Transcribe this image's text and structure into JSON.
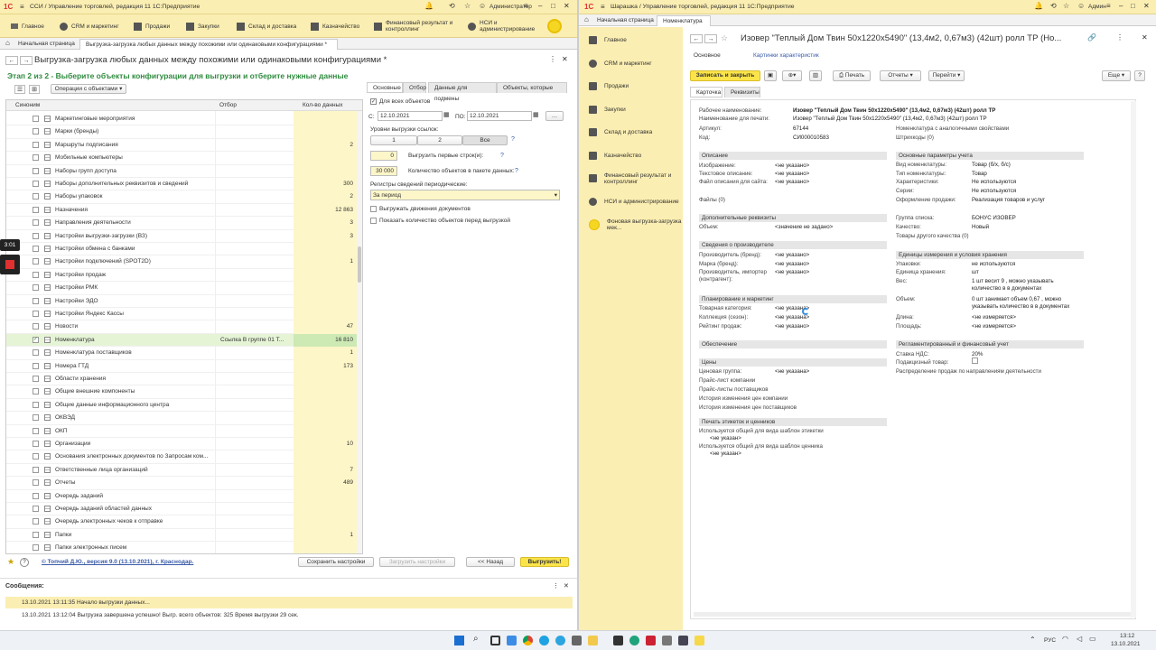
{
  "left": {
    "title": "ССИ / Управление торговлей, редакция 11 1С:Предприятие",
    "user": "Администратор",
    "menu": [
      "Главное",
      "CRM и маркетинг",
      "Продажи",
      "Закупки",
      "Склад и доставка",
      "Казначейство",
      "Финансовый результат и контроллинг",
      "НСИ и администрирование"
    ],
    "tabs": [
      "Начальная страница",
      "Выгрузка-загрузка любых данных между похожими или одинаковыми конфигурациями * ×"
    ],
    "form_title": "Выгрузка-загрузка любых данных между похожими или одинаковыми конфигурациями *",
    "step": "Этап 2 из 2 - Выберите объекты конфигурации для выгрузки и отберите нужные данные",
    "ops_label": "Операции с объектами",
    "col_synonym": "Синоним",
    "col_filter": "Отбор",
    "col_count": "Кол-во данных",
    "rows": [
      {
        "name": "Маркетинговые мероприятия",
        "filter": "",
        "count": ""
      },
      {
        "name": "Марки (бренды)",
        "filter": "",
        "count": ""
      },
      {
        "name": "Маршруты подписания",
        "filter": "",
        "count": "2"
      },
      {
        "name": "Мобильные компьютеры",
        "filter": "",
        "count": ""
      },
      {
        "name": "Наборы групп доступа",
        "filter": "",
        "count": ""
      },
      {
        "name": "Наборы дополнительных реквизитов и сведений",
        "filter": "",
        "count": "300"
      },
      {
        "name": "Наборы упаковок",
        "filter": "",
        "count": "2"
      },
      {
        "name": "Назначения",
        "filter": "",
        "count": "12 863"
      },
      {
        "name": "Направления деятельности",
        "filter": "",
        "count": "3"
      },
      {
        "name": "Настройки выгрузки-загрузки (ВЗ)",
        "filter": "",
        "count": "3"
      },
      {
        "name": "Настройки обмена с банками",
        "filter": "",
        "count": ""
      },
      {
        "name": "Настройки подключений (SPOT2D)",
        "filter": "",
        "count": "1"
      },
      {
        "name": "Настройки продаж",
        "filter": "",
        "count": ""
      },
      {
        "name": "Настройки РМК",
        "filter": "",
        "count": ""
      },
      {
        "name": "Настройки ЭДО",
        "filter": "",
        "count": ""
      },
      {
        "name": "Настройки Яндекс Кассы",
        "filter": "",
        "count": ""
      },
      {
        "name": "Новости",
        "filter": "",
        "count": "47"
      },
      {
        "name": "Номенклатура",
        "filter": "Ссылка В группе 01 Т...",
        "count": "16 810"
      },
      {
        "name": "Номенклатура поставщиков",
        "filter": "",
        "count": "1"
      },
      {
        "name": "Номера ГТД",
        "filter": "",
        "count": "173"
      },
      {
        "name": "Области хранения",
        "filter": "",
        "count": ""
      },
      {
        "name": "Общие внешние компоненты",
        "filter": "",
        "count": ""
      },
      {
        "name": "Общие данные информационного центра",
        "filter": "",
        "count": ""
      },
      {
        "name": "ОКВЭД",
        "filter": "",
        "count": ""
      },
      {
        "name": "ОКП",
        "filter": "",
        "count": ""
      },
      {
        "name": "Организации",
        "filter": "",
        "count": "10"
      },
      {
        "name": "Основания электронных документов по Запросам ком...",
        "filter": "",
        "count": ""
      },
      {
        "name": "Ответственные лица организаций",
        "filter": "",
        "count": "7"
      },
      {
        "name": "Отчеты",
        "filter": "",
        "count": "489"
      },
      {
        "name": "Очередь заданий",
        "filter": "",
        "count": ""
      },
      {
        "name": "Очередь заданий областей данных",
        "filter": "",
        "count": ""
      },
      {
        "name": "Очередь электронных чеков к отправке",
        "filter": "",
        "count": ""
      },
      {
        "name": "Папки",
        "filter": "",
        "count": "1"
      },
      {
        "name": "Папки электронных писем",
        "filter": "",
        "count": ""
      }
    ],
    "right_tabs": [
      "Основные",
      "Отбор",
      "Данные для подмены",
      "Объекты, которые бу..."
    ],
    "for_all": "Для всех объектов",
    "date_from_label": "С:",
    "date_from": "12.10.2021",
    "date_to_label": "ПО:",
    "date_to": "12.10.2021",
    "levels_label": "Уровни выгрузки ссылок:",
    "levels": [
      "1",
      "2",
      "Все"
    ],
    "first_rows_val": "0",
    "first_rows_label": "Выгрузить первые строк(и):",
    "packet_val": "30 000",
    "packet_label": "Количество объектов в пакете данных:",
    "registers_label": "Регистры сведений периодические:",
    "registers_val": "За период",
    "chk_movements": "Выгружать движения документов",
    "chk_show_count": "Показать количество объектов перед выгрузкой",
    "author": "© Топчий Д.Ю., версия 9.0 (13.10.2021), г. Краснодар.",
    "save_settings": "Сохранить настройки",
    "load_settings": "Загрузить настройки",
    "back": "<< Назад",
    "export": "Выгрузить!",
    "messages_title": "Сообщения:",
    "messages": [
      "13.10.2021 13:11:35 Начало выгрузки данных...",
      "13.10.2021 13:12:04 Выгрузка завершена успешно! Выгр. всего объектов: 325 Время выгрузки 29 сек."
    ],
    "timer": "3:01"
  },
  "right": {
    "title": "Шарашка / Управление торговлей, редакция 11 1С:Предприятие",
    "user": "Админ",
    "tabs": [
      "Начальная страница",
      "Номенклатура ×"
    ],
    "sidebar": [
      "Главное",
      "CRM и маркетинг",
      "Продажи",
      "Закупки",
      "Склад и доставка",
      "Казначейство",
      "Финансовый результат и контроллинг",
      "НСИ и администрирование",
      "Фоновая выгрузка-загрузка мек..."
    ],
    "card_title": "Изовер \"Теплый Дом Твин 50х1220х5490\" (13,4м2, 0,67м3) (42шт) ролл ТР (Но...",
    "nav_main": "Основное",
    "nav_chars": "Картинки характеристик",
    "write_close": "Записать и закрыть",
    "print": "Печать",
    "reports": "Отчеты",
    "goto": "Перейти",
    "more": "Еще",
    "help": "?",
    "subtabs": [
      "Карточка",
      "Реквизиты"
    ],
    "work_name_label": "Рабочее наименование:",
    "work_name": "Изовер \"Теплый Дом Твин 50х1220х5490\" (13,4м2, 0,67м3) (42шт) ролл ТР",
    "print_name_label": "Наименование для печати:",
    "print_name": "Изовер \"Теплый Дом Твин 50х1220х5490\" (13,4м2, 0,67м3) (42шт) ролл ТР",
    "article_label": "Артикул:",
    "article": "67144",
    "code_label": "Код:",
    "code": "СИ000010583",
    "analog_link": "Номенклатура с аналогичными свойствами",
    "barcodes_link": "Штрихкоды (0)",
    "s_description": "Описание",
    "image_label": "Изображение:",
    "not_set": "<не указано>",
    "text_desc_label": "Текстовое описание:",
    "site_file_label": "Файл описания для сайта:",
    "files_link": "Файлы (0)",
    "s_additional": "Дополнительные реквизиты",
    "volume_label": "Объем:",
    "value_not_set": "<значение не задано>",
    "s_manufacturer": "Сведения о производителе",
    "producer_label": "Производитель (бренд):",
    "brand_label": "Марка (бренд):",
    "importer_label": "Производитель, импортер (контрагент):",
    "s_planning": "Планирование и маркетинг",
    "category_label": "Товарная категория:",
    "not_set_f": "<не указана>",
    "collection_label": "Коллекция (сезон):",
    "rating_label": "Рейтинг продаж:",
    "s_supply": "Обеспечение",
    "s_prices": "Цены",
    "price_group_label": "Ценовая группа:",
    "price_links": [
      "Прайс-лист компании",
      "Прайс-листы поставщиков",
      "История изменения цен компании",
      "История изменения цен поставщиков"
    ],
    "s_labels": "Печать этикеток и ценников",
    "label_tmpl": "Используется общий для вида шаблон этикетки",
    "label_tmpl_val": "<не указан>",
    "price_tmpl": "Используется общий для вида шаблон ценника",
    "price_tmpl_val": "<не указан>",
    "s_accounting": "Основные параметры учета",
    "kind_label": "Вид номенклатуры:",
    "kind": "Товар (б/х, б/с)",
    "type_label": "Тип номенклатуры:",
    "type": "Товар",
    "chars_label": "Характеристики:",
    "not_used": "Не используются",
    "series_label": "Серии:",
    "sale_label": "Оформление продажи:",
    "sale": "Реализация товаров и услуг",
    "group_label": "Группа списка:",
    "group": "БОНУС ИЗОВЕР",
    "quality_label": "Качество:",
    "quality": "Новый",
    "other_quality": "Товары другого качества (0)",
    "s_units": "Единицы измерения и условия хранения",
    "packs_label": "Упаковки:",
    "packs": "не используются",
    "unit_label": "Единица хранения:",
    "unit": "шт",
    "weight_label": "Вес:",
    "weight": "1 шт весит 9 , можно указывать количество в в документах",
    "vol_label": "Объем:",
    "vol": "0 шт занимает объем 0,67 , можно указывать количество в в документах",
    "length_label": "Длина:",
    "not_measured": "<не измеряется>",
    "area_label": "Площадь:",
    "s_regulated": "Регламентированный и финансовый учет",
    "vat_label": "Ставка НДС:",
    "vat": "20%",
    "excise_label": "Подакцизный товар:",
    "distribution_link": "Распределение продаж по направлениям деятельности"
  },
  "taskbar": {
    "lang": "РУС",
    "time": "13:12",
    "date": "13.10.2021"
  }
}
